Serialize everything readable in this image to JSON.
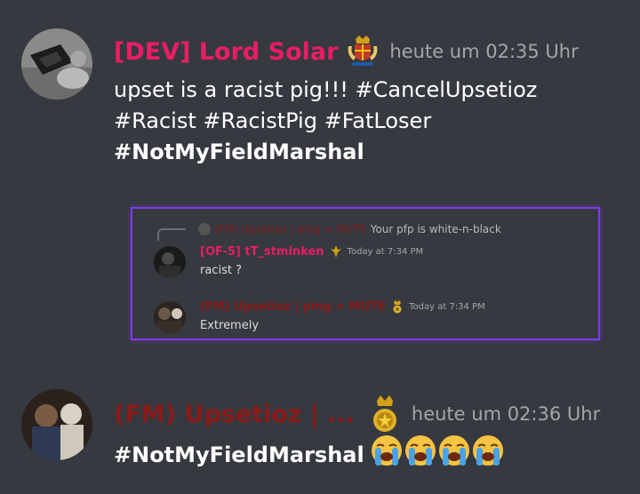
{
  "messages": [
    {
      "username": "[DEV] Lord Solar",
      "username_color": "#e91e63",
      "badge_icon": "royal-crest-icon",
      "timestamp": "heute um 02:35 Uhr",
      "lines": [
        "upset is a racist pig!!! #CancelUpsetioz",
        "#Racist #RacistPig #FatLoser",
        "#NotMyFieldMarshal"
      ]
    },
    {
      "username": "(FM) Upsetioz | ...",
      "username_color": "#8b1a1a",
      "badge_icon": "crown-medal-icon",
      "timestamp": "heute um 02:36 Uhr",
      "text": "#NotMyFieldMarshal",
      "emoji": [
        "loudly-crying-face-icon",
        "loudly-crying-face-icon",
        "loudly-crying-face-icon",
        "loudly-crying-face-icon"
      ]
    }
  ],
  "screenshot": {
    "reply_author": "(FM) Upsetioz | ping = MUTE",
    "reply_text": "Your pfp is white-n-black",
    "messages": [
      {
        "username": "[OF-5] tT_stminken",
        "username_color": "#e91e63",
        "badge_icon": "wings-badge-icon",
        "timestamp": "Today at 7:34 PM",
        "text": "racist ?"
      },
      {
        "username": "(FM) Upsetioz | ping = MUTE",
        "username_color": "#8b1a1a",
        "badge_icon": "crown-medal-icon",
        "timestamp": "Today at 7:34 PM",
        "text": "Extremely"
      }
    ],
    "border_color": "#7c3aed"
  }
}
